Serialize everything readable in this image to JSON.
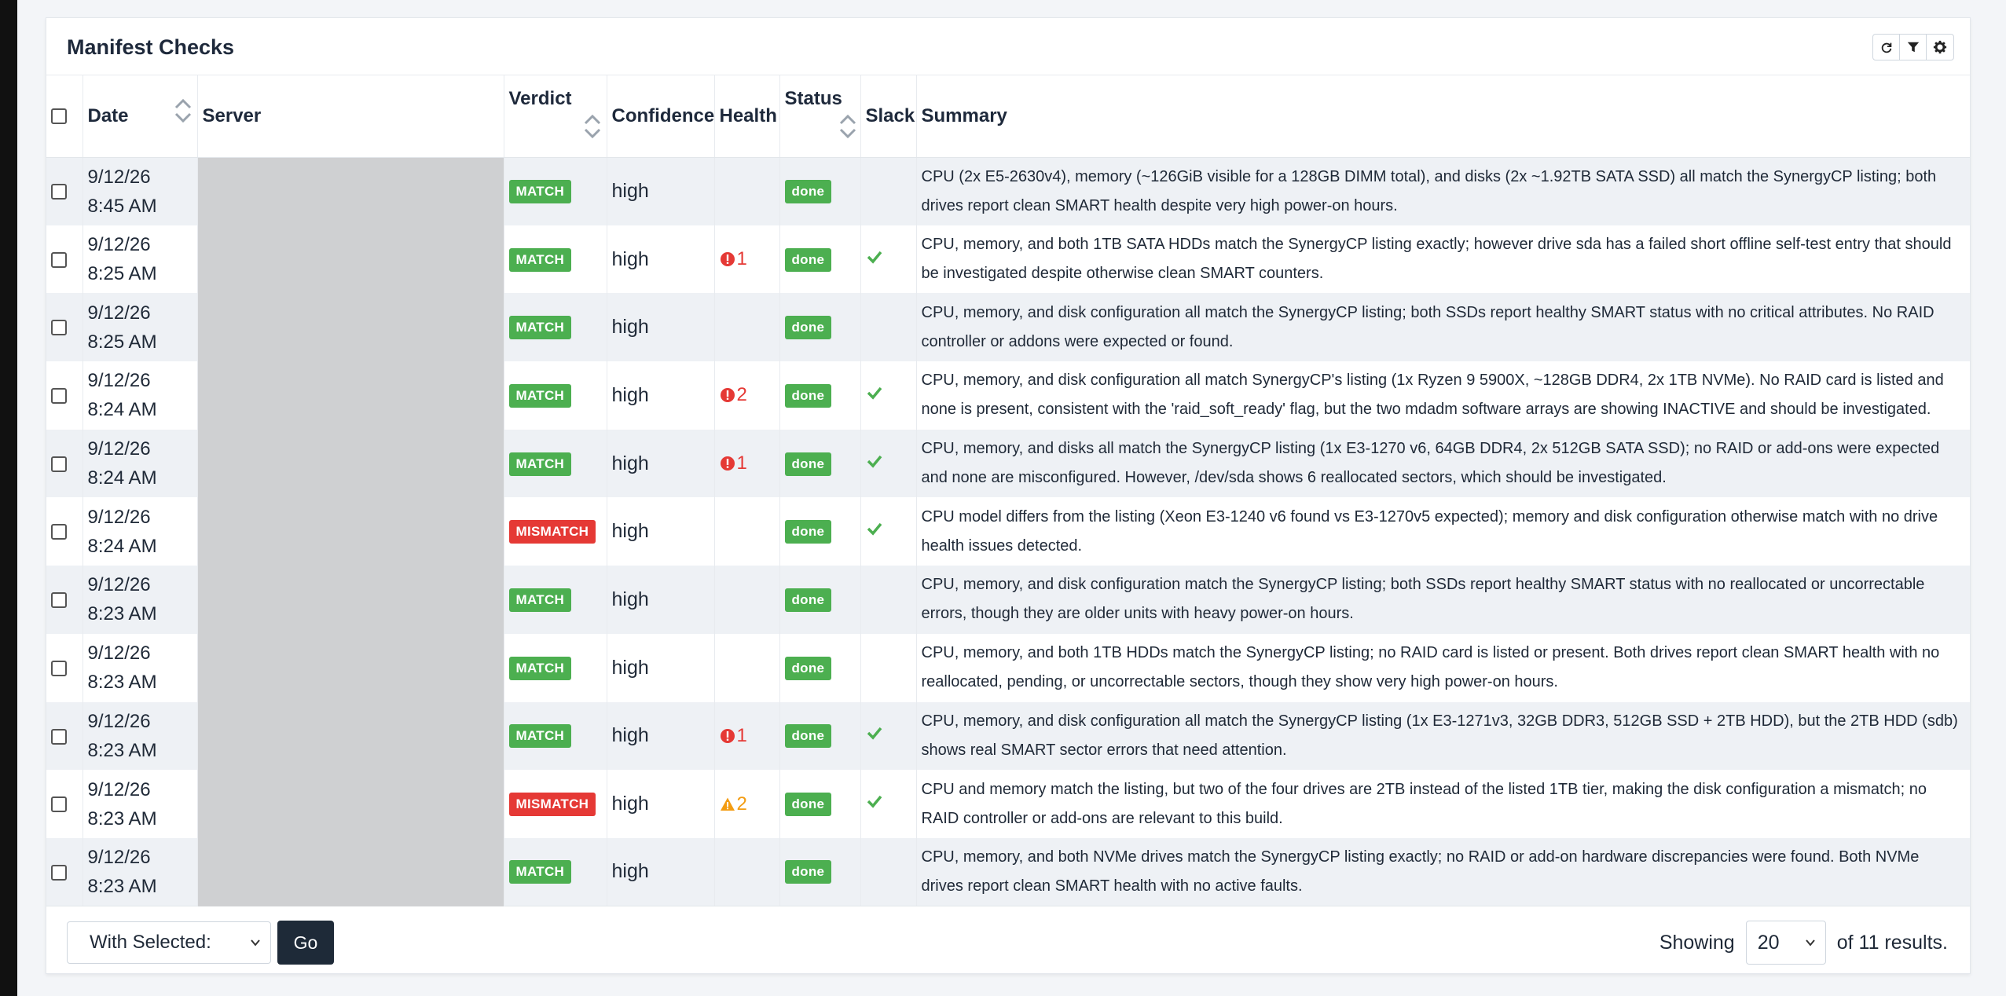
{
  "panel": {
    "title": "Manifest Checks"
  },
  "toolbar": {
    "icons": [
      "refresh-icon",
      "filter-icon",
      "gear-icon"
    ]
  },
  "columns": {
    "date": "Date",
    "server": "Server",
    "verdict": "Verdict",
    "confidence": "Confidence",
    "health": "Health",
    "status": "Status",
    "slack": "Slack",
    "summary": "Summary"
  },
  "rows": [
    {
      "date": "9/12/26",
      "time": "8:45 AM",
      "verdict": "MATCH",
      "confidence": "high",
      "health": "",
      "health_type": "",
      "status": "done",
      "slack": false,
      "summary": "CPU (2x E5-2630v4), memory (~126GiB visible for a 128GB DIMM total), and disks (2x ~1.92TB SATA SSD) all match the SynergyCP listing; both drives report clean SMART health despite very high power-on hours."
    },
    {
      "date": "9/12/26",
      "time": "8:25 AM",
      "verdict": "MATCH",
      "confidence": "high",
      "health": "1",
      "health_type": "error",
      "status": "done",
      "slack": true,
      "summary": "CPU, memory, and both 1TB SATA HDDs match the SynergyCP listing exactly; however drive sda has a failed short offline self-test entry that should be investigated despite otherwise clean SMART counters."
    },
    {
      "date": "9/12/26",
      "time": "8:25 AM",
      "verdict": "MATCH",
      "confidence": "high",
      "health": "",
      "health_type": "",
      "status": "done",
      "slack": false,
      "summary": "CPU, memory, and disk configuration all match the SynergyCP listing; both SSDs report healthy SMART status with no critical attributes. No RAID controller or addons were expected or found."
    },
    {
      "date": "9/12/26",
      "time": "8:24 AM",
      "verdict": "MATCH",
      "confidence": "high",
      "health": "2",
      "health_type": "error",
      "status": "done",
      "slack": true,
      "summary": "CPU, memory, and disk configuration all match SynergyCP's listing (1x Ryzen 9 5900X, ~128GB DDR4, 2x 1TB NVMe). No RAID card is listed and none is present, consistent with the 'raid_soft_ready' flag, but the two mdadm software arrays are showing INACTIVE and should be investigated."
    },
    {
      "date": "9/12/26",
      "time": "8:24 AM",
      "verdict": "MATCH",
      "confidence": "high",
      "health": "1",
      "health_type": "error",
      "status": "done",
      "slack": true,
      "summary": "CPU, memory, and disks all match the SynergyCP listing (1x E3-1270 v6, 64GB DDR4, 2x 512GB SATA SSD); no RAID or add-ons were expected and none are misconfigured. However, /dev/sda shows 6 reallocated sectors, which should be investigated."
    },
    {
      "date": "9/12/26",
      "time": "8:24 AM",
      "verdict": "MISMATCH",
      "confidence": "high",
      "health": "",
      "health_type": "",
      "status": "done",
      "slack": true,
      "summary": "CPU model differs from the listing (Xeon E3-1240 v6 found vs E3-1270v5 expected); memory and disk configuration otherwise match with no drive health issues detected."
    },
    {
      "date": "9/12/26",
      "time": "8:23 AM",
      "verdict": "MATCH",
      "confidence": "high",
      "health": "",
      "health_type": "",
      "status": "done",
      "slack": false,
      "summary": "CPU, memory, and disk configuration match the SynergyCP listing; both SSDs report healthy SMART status with no reallocated or uncorrectable errors, though they are older units with heavy power-on hours."
    },
    {
      "date": "9/12/26",
      "time": "8:23 AM",
      "verdict": "MATCH",
      "confidence": "high",
      "health": "",
      "health_type": "",
      "status": "done",
      "slack": false,
      "summary": "CPU, memory, and both 1TB HDDs match the SynergyCP listing; no RAID card is listed or present. Both drives report clean SMART health with no reallocated, pending, or uncorrectable sectors, though they show very high power-on hours."
    },
    {
      "date": "9/12/26",
      "time": "8:23 AM",
      "verdict": "MATCH",
      "confidence": "high",
      "health": "1",
      "health_type": "error",
      "status": "done",
      "slack": true,
      "summary": "CPU, memory, and disk configuration all match the SynergyCP listing (1x E3-1271v3, 32GB DDR3, 512GB SSD + 2TB HDD), but the 2TB HDD (sdb) shows real SMART sector errors that need attention."
    },
    {
      "date": "9/12/26",
      "time": "8:23 AM",
      "verdict": "MISMATCH",
      "confidence": "high",
      "health": "2",
      "health_type": "warning",
      "status": "done",
      "slack": true,
      "summary": "CPU and memory match the listing, but two of the four drives are 2TB instead of the listed 1TB tier, making the disk configuration a mismatch; no RAID controller or add-ons are relevant to this build."
    },
    {
      "date": "9/12/26",
      "time": "8:23 AM",
      "verdict": "MATCH",
      "confidence": "high",
      "health": "",
      "health_type": "",
      "status": "done",
      "slack": false,
      "summary": "CPU, memory, and both NVMe drives match the SynergyCP listing exactly; no RAID or add-on hardware discrepancies were found. Both NVMe drives report clean SMART health with no active faults."
    }
  ],
  "footer": {
    "bulk_select_value": "With Selected:",
    "go_label": "Go",
    "showing_label": "Showing",
    "per_page_value": "20",
    "results_label": "of 11 results."
  },
  "colors": {
    "match": "#4caf50",
    "mismatch": "#e53935",
    "done": "#4caf50",
    "error": "#e53935",
    "warning": "#f39c12",
    "go_button": "#1e2a38"
  }
}
